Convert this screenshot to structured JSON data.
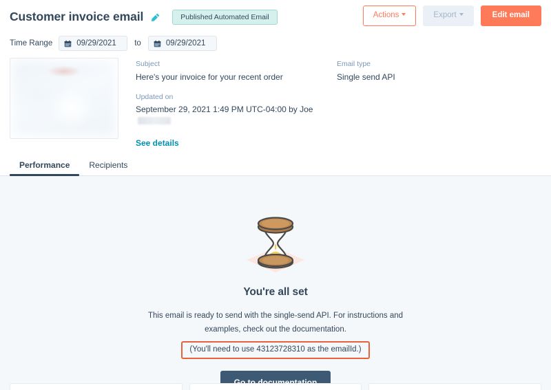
{
  "header": {
    "title": "Customer invoice email",
    "edit_title_icon": "pencil-icon",
    "status_badge": "Published Automated Email",
    "actions_label": "Actions",
    "export_label": "Export",
    "edit_email_label": "Edit email"
  },
  "time_range": {
    "label": "Time Range",
    "start_date": "09/29/2021",
    "separator": "to",
    "end_date": "09/29/2021",
    "calendar_icon": "calendar-icon"
  },
  "details": {
    "subject_label": "Subject",
    "subject_value": "Here's your invoice for your recent order",
    "email_type_label": "Email type",
    "email_type_value": "Single send API",
    "updated_on_label": "Updated on",
    "updated_on_value": "September 29, 2021 1:49 PM UTC-04:00 by Joe",
    "see_details_link": "See details"
  },
  "tabs": [
    {
      "label": "Performance",
      "active": true
    },
    {
      "label": "Recipients",
      "active": false
    }
  ],
  "empty_state": {
    "illustration": "hourglass-illustration",
    "title": "You're all set",
    "body": "This email is ready to send with the single-send API. For instructions and examples, check out the documentation.",
    "emailid_note": "(You'll need to use 43123728310 as the emailId.)",
    "emailid": "43123728310",
    "cta_label": "Go to documentation"
  },
  "colors": {
    "accent_orange": "#ff7a59",
    "highlight_orange": "#e8603c",
    "text_dark": "#33475b",
    "link_teal": "#0091ae",
    "badge_teal_bg": "#d6f0ed",
    "badge_teal_border": "#9fd8d2",
    "cta_navy": "#3e5974",
    "content_bg": "#f5f8fa"
  }
}
